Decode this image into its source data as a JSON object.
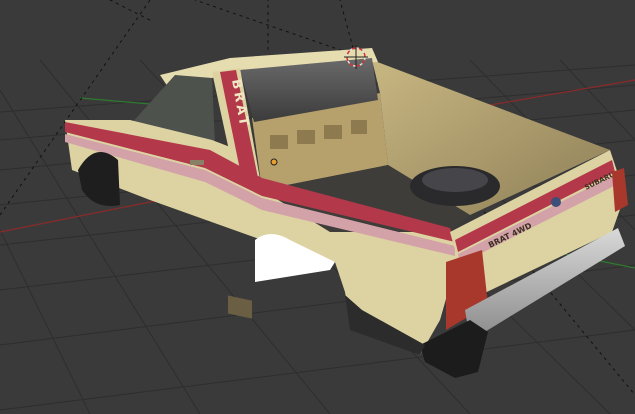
{
  "viewport": {
    "background": "#3a3a3a",
    "grid_color": "#2e2e2e",
    "x_axis_color": "#8a2a2a",
    "y_axis_color": "#2f7a2f"
  },
  "model": {
    "body_color": "#ddd3a2",
    "stripe_color": "#b3384a",
    "side_text": "BRAT",
    "tailgate_left_badge": "BRAT 4WD",
    "tailgate_right_badge": "SUBARU",
    "tail_light_color": "#a8382c"
  },
  "overlays": {
    "cursor_icon": "3d-cursor-icon",
    "origin_icon": "object-origin-icon"
  }
}
